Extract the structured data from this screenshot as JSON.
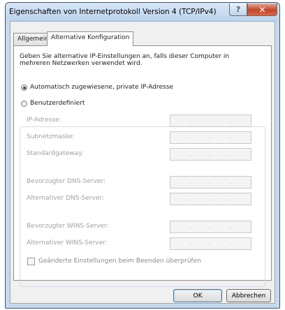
{
  "window": {
    "title": "Eigenschaften von Internetprotokoll Version 4 (TCP/IPv4)",
    "help_icon": "?",
    "close_icon": "✕"
  },
  "tabs": [
    {
      "label": "Allgemein",
      "active": false
    },
    {
      "label": "Alternative Konfiguration",
      "active": true
    }
  ],
  "panel": {
    "description": "Geben Sie alternative IP-Einstellungen an, falls dieser Computer in mehreren Netzwerken verwendet wird.",
    "radio_auto": {
      "label": "Automatisch zugewiesene, private IP-Adresse",
      "checked": true
    },
    "radio_manual": {
      "label": "Benutzerdefiniert",
      "checked": false
    },
    "fields": [
      {
        "label": "IP-Adresse:",
        "value": ". . ."
      },
      {
        "label": "Subnetzmaske:",
        "value": ". . ."
      },
      {
        "label": "Standardgateway:",
        "value": ". . ."
      },
      {
        "label": "Bevorzugter DNS-Server:",
        "value": ". . ."
      },
      {
        "label": "Alternativer DNS-Server:",
        "value": ". . ."
      },
      {
        "label": "Bevorzugter WINS-Server:",
        "value": ". . ."
      },
      {
        "label": "Alternativer WINS-Server:",
        "value": ". . ."
      }
    ],
    "validate_checkbox": {
      "label": "Geänderte Einstellungen beim Beenden überprüfen",
      "checked": false
    }
  },
  "buttons": {
    "ok": "OK",
    "cancel": "Abbrechen"
  },
  "colors": {
    "window_frame": "#c6d9ee",
    "close_button": "#c4452a",
    "radio_dot": "#27476e",
    "disabled_text": "#a0a0a0"
  }
}
